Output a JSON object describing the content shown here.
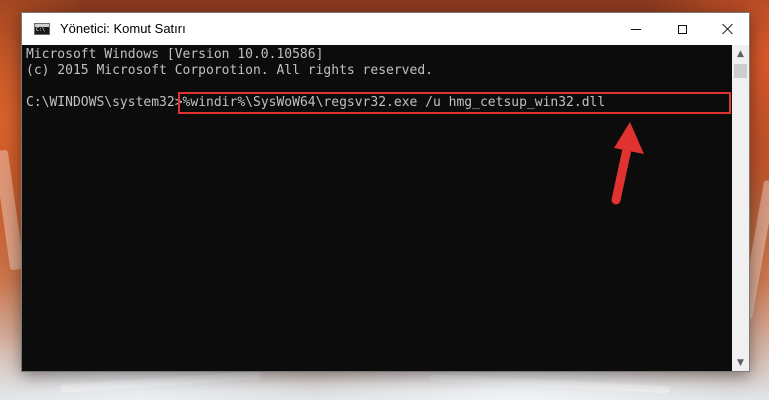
{
  "window": {
    "title": "Yönetici: Komut Satırı",
    "icon": "cmd-icon"
  },
  "controls": {
    "minimize_icon": "minimize-icon",
    "maximize_icon": "maximize-icon",
    "close_icon": "close-icon"
  },
  "console": {
    "lines": [
      "Microsoft Windows [Version 10.0.10586]",
      "(c) 2015 Microsoft Corporotion. All rights reserved."
    ],
    "prompt": "C:\\WINDOWS\\system32>",
    "command": "%windir%\\SysWoW64\\regsvr32.exe /u hmg_cetsup_win32.dll"
  },
  "scrollbar": {
    "up_glyph": "▲",
    "down_glyph": "▼"
  },
  "annotation": {
    "highlight_color": "#e0322f",
    "arrow_color": "#e0322f"
  }
}
